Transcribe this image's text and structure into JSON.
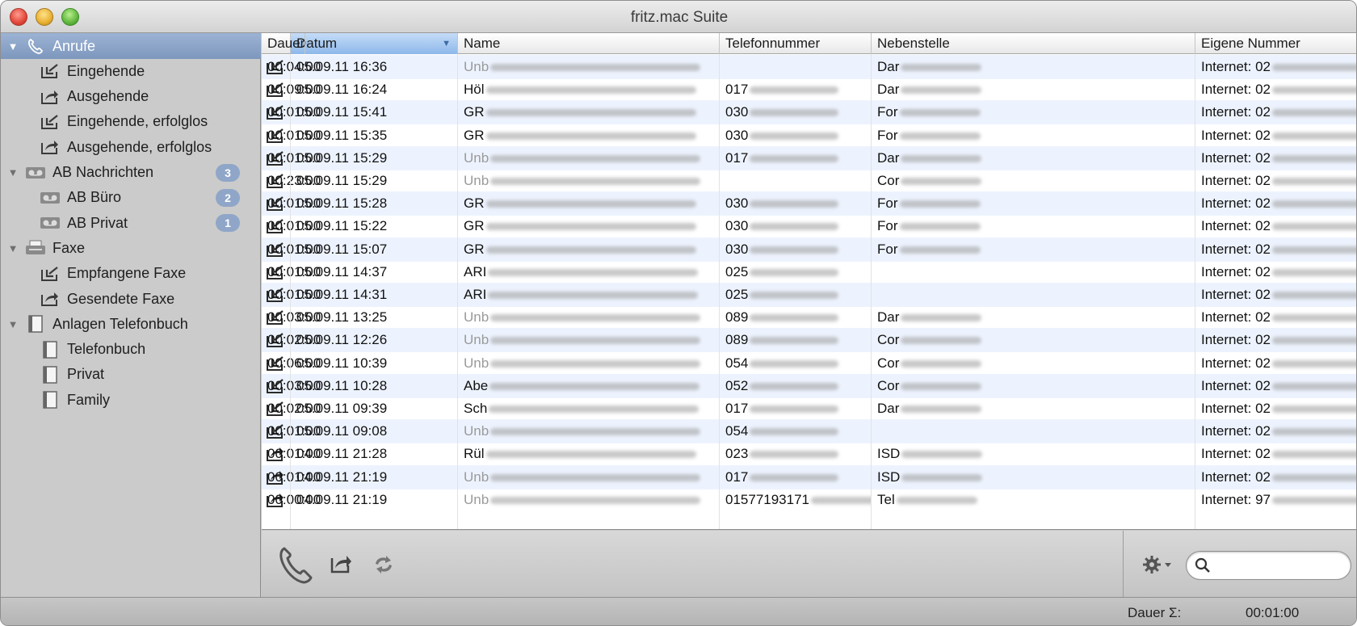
{
  "window": {
    "title": "fritz.mac Suite"
  },
  "sidebar": {
    "items": [
      {
        "label": "Anrufe",
        "icon": "phone-icon",
        "level": 0,
        "selected": true,
        "badge": ""
      },
      {
        "label": "Eingehende",
        "icon": "incoming-call-icon",
        "level": 1,
        "badge": ""
      },
      {
        "label": "Ausgehende",
        "icon": "outgoing-call-icon",
        "level": 1,
        "badge": ""
      },
      {
        "label": "Eingehende, erfolglos",
        "icon": "incoming-missed-icon",
        "level": 1,
        "badge": ""
      },
      {
        "label": "Ausgehende, erfolglos",
        "icon": "outgoing-missed-icon",
        "level": 1,
        "badge": ""
      },
      {
        "label": "AB Nachrichten",
        "icon": "answering-machine-icon",
        "level": 0,
        "badge": "3"
      },
      {
        "label": "AB Büro",
        "icon": "answering-machine-icon",
        "level": 1,
        "badge": "2"
      },
      {
        "label": "AB Privat",
        "icon": "answering-machine-icon",
        "level": 1,
        "badge": "1"
      },
      {
        "label": "Faxe",
        "icon": "fax-icon",
        "level": 0,
        "badge": ""
      },
      {
        "label": "Empfangene Faxe",
        "icon": "incoming-call-icon",
        "level": 1,
        "badge": ""
      },
      {
        "label": "Gesendete Faxe",
        "icon": "outgoing-call-icon",
        "level": 1,
        "badge": ""
      },
      {
        "label": "Anlagen Telefonbuch",
        "icon": "phonebook-icon",
        "level": 0,
        "badge": ""
      },
      {
        "label": "Telefonbuch",
        "icon": "phonebook-icon",
        "level": 1,
        "badge": ""
      },
      {
        "label": "Privat",
        "icon": "phonebook-icon",
        "level": 1,
        "badge": ""
      },
      {
        "label": "Family",
        "icon": "phonebook-icon",
        "level": 1,
        "badge": ""
      }
    ]
  },
  "table": {
    "columns": [
      "Datum",
      "Name",
      "Telefonnummer",
      "Nebenstelle",
      "Eigene Nummer",
      "Dauer"
    ],
    "sort_column": "Datum",
    "rows": [
      {
        "dir": "in",
        "datum": "05.09.11 16:36",
        "name": "Unb",
        "name_gray": true,
        "tel": "",
        "neben": "Dar",
        "eigene": "Internet: 02",
        "dauer": "00:04:00"
      },
      {
        "dir": "in",
        "datum": "05.09.11 16:24",
        "name": "Höl",
        "name_gray": false,
        "tel": "017",
        "neben": "Dar",
        "eigene": "Internet: 02",
        "dauer": "00:09:00"
      },
      {
        "dir": "in",
        "datum": "05.09.11 15:41",
        "name": "GR",
        "name_gray": false,
        "tel": "030",
        "neben": "For",
        "eigene": "Internet: 02",
        "dauer": "00:01:00"
      },
      {
        "dir": "in",
        "datum": "05.09.11 15:35",
        "name": "GR",
        "name_gray": false,
        "tel": "030",
        "neben": "For",
        "eigene": "Internet: 02",
        "dauer": "00:01:00"
      },
      {
        "dir": "in",
        "datum": "05.09.11 15:29",
        "name": "Unb",
        "name_gray": true,
        "tel": "017",
        "neben": "Dar",
        "eigene": "Internet: 02",
        "dauer": "00:01:00"
      },
      {
        "dir": "in",
        "datum": "05.09.11 15:29",
        "name": "Unb",
        "name_gray": true,
        "tel": "",
        "neben": "Cor",
        "eigene": "Internet: 02",
        "dauer": "00:23:00"
      },
      {
        "dir": "in",
        "datum": "05.09.11 15:28",
        "name": "GR",
        "name_gray": false,
        "tel": "030",
        "neben": "For",
        "eigene": "Internet: 02",
        "dauer": "00:01:00"
      },
      {
        "dir": "in",
        "datum": "05.09.11 15:22",
        "name": "GR",
        "name_gray": false,
        "tel": "030",
        "neben": "For",
        "eigene": "Internet: 02",
        "dauer": "00:01:00"
      },
      {
        "dir": "in",
        "datum": "05.09.11 15:07",
        "name": "GR",
        "name_gray": false,
        "tel": "030",
        "neben": "For",
        "eigene": "Internet: 02",
        "dauer": "00:01:00"
      },
      {
        "dir": "in",
        "datum": "05.09.11 14:37",
        "name": "ARI",
        "name_gray": false,
        "tel": "025",
        "neben": "",
        "eigene": "Internet: 02",
        "dauer": "00:01:00"
      },
      {
        "dir": "in",
        "datum": "05.09.11 14:31",
        "name": "ARI",
        "name_gray": false,
        "tel": "025",
        "neben": "",
        "eigene": "Internet: 02",
        "dauer": "00:01:00"
      },
      {
        "dir": "in",
        "datum": "05.09.11 13:25",
        "name": "Unb",
        "name_gray": true,
        "tel": "089",
        "neben": "Dar",
        "eigene": "Internet: 02",
        "dauer": "00:03:00"
      },
      {
        "dir": "in",
        "datum": "05.09.11 12:26",
        "name": "Unb",
        "name_gray": true,
        "tel": "089",
        "neben": "Cor",
        "eigene": "Internet: 02",
        "dauer": "00:02:00"
      },
      {
        "dir": "in",
        "datum": "05.09.11 10:39",
        "name": "Unb",
        "name_gray": true,
        "tel": "054",
        "neben": "Cor",
        "eigene": "Internet: 02",
        "dauer": "00:06:00"
      },
      {
        "dir": "in",
        "datum": "05.09.11 10:28",
        "name": "Abe",
        "name_gray": false,
        "tel": "052",
        "neben": "Cor",
        "eigene": "Internet: 02",
        "dauer": "00:03:00"
      },
      {
        "dir": "in",
        "datum": "05.09.11 09:39",
        "name": "Sch",
        "name_gray": false,
        "tel": "017",
        "neben": "Dar",
        "eigene": "Internet: 02",
        "dauer": "00:02:00"
      },
      {
        "dir": "in",
        "datum": "05.09.11 09:08",
        "name": "Unb",
        "name_gray": true,
        "tel": "054",
        "neben": "",
        "eigene": "Internet: 02",
        "dauer": "00:01:00"
      },
      {
        "dir": "out",
        "datum": "04.09.11 21:28",
        "name": "Rül",
        "name_gray": false,
        "tel": "023",
        "neben": "ISD",
        "eigene": "Internet: 02",
        "dauer": "00:01:00"
      },
      {
        "dir": "out",
        "datum": "04.09.11 21:19",
        "name": "Unb",
        "name_gray": true,
        "tel": "017",
        "neben": "ISD",
        "eigene": "Internet: 02",
        "dauer": "00:01:00"
      },
      {
        "dir": "out",
        "datum": "04.09.11 21:19",
        "name": "Unb",
        "name_gray": true,
        "tel": "01577193171",
        "neben": "Tel",
        "eigene": "Internet: 97",
        "dauer": "00:00:00"
      }
    ]
  },
  "toolbar": {
    "call_icon": "phone-handset-icon",
    "forward_icon": "forward-icon",
    "sync_icon": "sync-icon",
    "gear_icon": "gear-icon",
    "search_icon": "search-icon",
    "search_value": ""
  },
  "status": {
    "label": "Dauer Σ:",
    "value": "00:01:00"
  },
  "colors": {
    "selection": "#7d97bd",
    "badge": "#8fa6c8",
    "row_alt": "#edf3fe",
    "sorted_header": "#8db8ea"
  }
}
